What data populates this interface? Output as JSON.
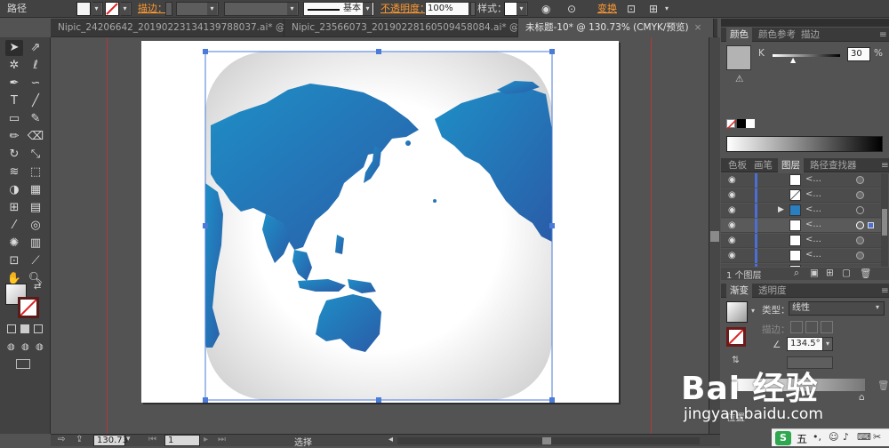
{
  "control_bar": {
    "object_type": "路径",
    "stroke_label": "描边：",
    "stroke_style_label": "基本",
    "opacity_label": "不透明度：",
    "opacity_value": "100%",
    "style_label": "样式：",
    "transform_label": "变换"
  },
  "tabs": [
    {
      "label": "Nipic_24206642_20190223134139788037.ai* @ 50...",
      "close": "×"
    },
    {
      "label": "Nipic_23566073_20190228160509458084.ai* @ 98...",
      "close": "×"
    },
    {
      "label": "未标题-10* @ 130.73% (CMYK/预览)",
      "close": "×"
    }
  ],
  "color_panel": {
    "tabs": [
      "颜色",
      "颜色参考",
      "描边"
    ],
    "channel": "K",
    "value": "30",
    "unit": "%"
  },
  "layers_panel": {
    "tabs": [
      "色板",
      "画笔",
      "图层",
      "路径查找器"
    ],
    "rows": [
      {
        "name": "<..."
      },
      {
        "name": "<..."
      },
      {
        "name": "<..."
      },
      {
        "name": "<..."
      },
      {
        "name": "<..."
      },
      {
        "name": "<..."
      },
      {
        "name": "<..."
      }
    ],
    "footer": "1 个图层"
  },
  "gradient_panel": {
    "tabs": [
      "渐变",
      "透明度"
    ],
    "type_label": "类型：",
    "type_value": "线性",
    "stroke_label": "描边：",
    "angle_value": "134.5°",
    "position_label": "位置"
  },
  "status_bar": {
    "zoom": "130.73",
    "page": "1",
    "tool": "选择"
  },
  "watermark": {
    "brand": "Bai 经验",
    "url": "jingyan.baidu.com"
  },
  "tray": {
    "ime": "五"
  },
  "colors": {
    "globe_blue_start": "#1e8fc6",
    "globe_blue_end": "#2a5ca8",
    "accent_orange": "#ff9a32",
    "guide_red": "#b03a3a"
  }
}
